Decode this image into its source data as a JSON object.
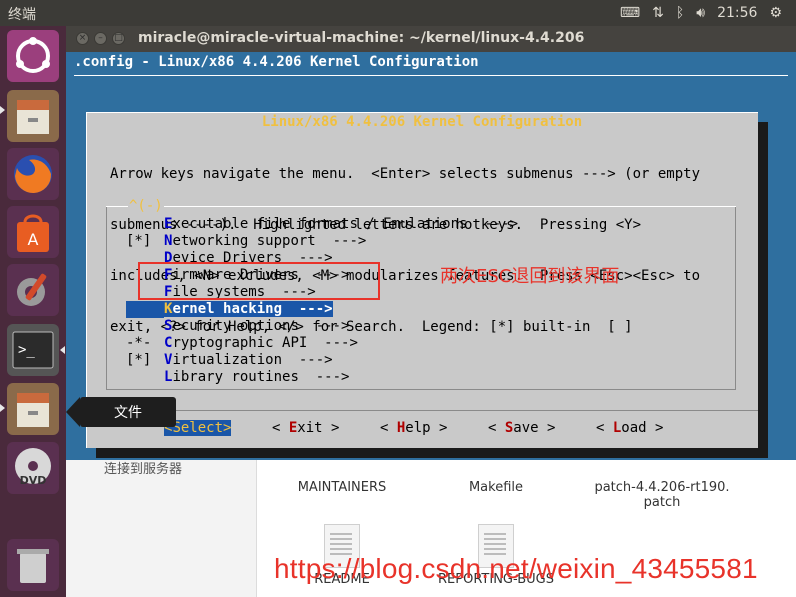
{
  "top_panel": {
    "app_name": "终端",
    "time": "21:56",
    "icons": [
      "keyboard-icon",
      "network-icon",
      "bluetooth-icon",
      "volume-icon",
      "power-gear-icon"
    ]
  },
  "launcher": {
    "items": [
      "ubuntu-dash",
      "files",
      "firefox",
      "software-center",
      "system-settings",
      "terminal",
      "files",
      "dvd",
      "trash"
    ],
    "tooltip": "文件"
  },
  "window": {
    "title": "miracle@miracle-virtual-machine: ~/kernel/linux-4.4.206"
  },
  "terminal": {
    "header": ".config - Linux/x86 4.4.206 Kernel Configuration",
    "dialog_title": "Linux/x86 4.4.206 Kernel Configuration",
    "help_lines": [
      "Arrow keys navigate the menu.  <Enter> selects submenus ---> (or empty",
      "submenus ----).  Highlighted letters are hotkeys.  Pressing <Y>",
      "includes, <N> excludes, <M> modularizes features.  Press <Esc><Esc> to",
      "exit, <?> for Help, </> for Search.  Legend: [*] built-in  [ ]"
    ],
    "menu_tag": "^(-)",
    "menu_items": [
      {
        "prefix": "   ",
        "hotkey": "E",
        "rest": "xecutable file formats / Emulations  --->"
      },
      {
        "prefix": "[*]",
        "hotkey": "N",
        "rest": "etworking support  --->"
      },
      {
        "prefix": "   ",
        "hotkey": "D",
        "rest": "evice Drivers  --->"
      },
      {
        "prefix": "   ",
        "hotkey": "F",
        "rest": "irmware Drivers  --->"
      },
      {
        "prefix": "   ",
        "hotkey": "F",
        "rest": "ile systems  --->"
      },
      {
        "prefix": "   ",
        "hotkey": "K",
        "rest": "ernel hacking  --->"
      },
      {
        "prefix": "   ",
        "hotkey": "S",
        "rest": "ecurity options  --->"
      },
      {
        "prefix": "-*-",
        "hotkey": "C",
        "rest": "ryptographic API  --->"
      },
      {
        "prefix": "[*]",
        "hotkey": "V",
        "rest": "irtualization  --->"
      },
      {
        "prefix": "   ",
        "hotkey": "L",
        "rest": "ibrary routines  --->"
      }
    ],
    "buttons": [
      {
        "open": "<",
        "hotkey": "S",
        "rest": "elect",
        "close": ">"
      },
      {
        "open": "< ",
        "hotkey": "E",
        "rest": "xit",
        "close": " >"
      },
      {
        "open": "< ",
        "hotkey": "H",
        "rest": "elp",
        "close": " >"
      },
      {
        "open": "< ",
        "hotkey": "S",
        "rest": "ave",
        "close": " >"
      },
      {
        "open": "< ",
        "hotkey": "L",
        "rest": "oad",
        "close": " >"
      }
    ]
  },
  "annotation": {
    "text": "两次ESC退回到该界面"
  },
  "file_manager": {
    "sidebar_item": "连接到服务器",
    "files": [
      "MAINTAINERS",
      "Makefile",
      "patch-4.4.206-rt190.\npatch",
      "README",
      "REPORTING-BUGS"
    ]
  },
  "watermark": "https://blog.csdn.net/weixin_43455581",
  "colors": {
    "terminal_bg": "#2f6f9f",
    "dialog_bg": "#c9c9c9",
    "selection": "#1a56a8",
    "annotation": "#e8332a",
    "launcher_bg": "#4a2a3c"
  }
}
